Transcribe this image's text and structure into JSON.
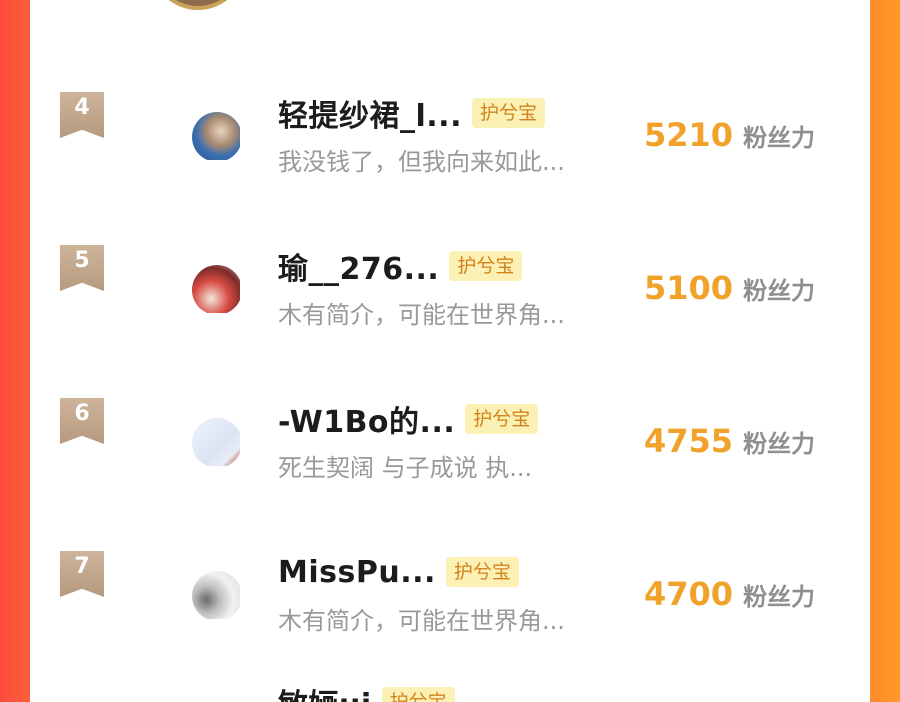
{
  "leaderboard": {
    "score_unit": "粉丝力",
    "badge_label": "护兮宝",
    "rows": [
      {
        "rank": "4",
        "name": "轻提纱裙_l...",
        "badge": "护兮宝",
        "desc": "我没钱了，但我向来如此...",
        "score": "5210",
        "unit": "粉丝力"
      },
      {
        "rank": "5",
        "name": "瑜__276...",
        "badge": "护兮宝",
        "desc": "木有简介，可能在世界角...",
        "score": "5100",
        "unit": "粉丝力"
      },
      {
        "rank": "6",
        "name": "-W1Bo的...",
        "badge": "护兮宝",
        "desc": "死生契阔 与子成说 执...",
        "score": "4755",
        "unit": "粉丝力"
      },
      {
        "rank": "7",
        "name": "MissPu...",
        "badge": "护兮宝",
        "desc": "木有简介，可能在世界角...",
        "score": "4700",
        "unit": "粉丝力"
      }
    ],
    "partial_row": {
      "name": "敏婳ui",
      "badge": "护兮宝"
    }
  },
  "colors": {
    "background_left": "#fb4a3c",
    "background_right": "#ff9a26",
    "score": "#f0a22b",
    "badge_bg": "#fbf1b4",
    "badge_text": "#d2831e",
    "rank_badge": "#c4a98d"
  }
}
